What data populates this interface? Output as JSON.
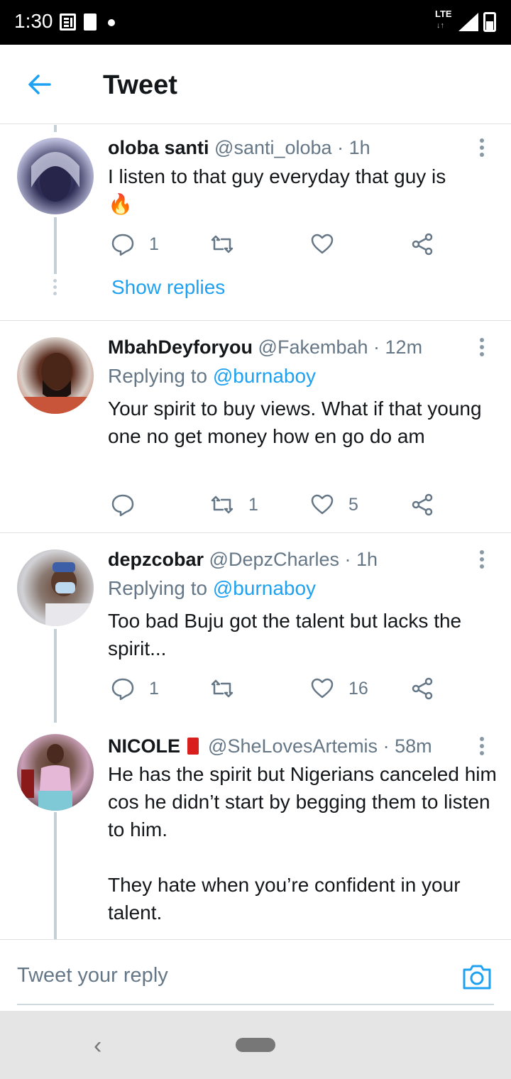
{
  "status": {
    "time": "1:30",
    "network": "LTE"
  },
  "header": {
    "title": "Tweet"
  },
  "tweets": [
    {
      "name": "oloba santi",
      "handle": "@santi_oloba",
      "time": "· 1h",
      "text": "I listen to that guy everyday that guy is",
      "emoji": "🔥",
      "reply_count": "1",
      "retweet_count": "",
      "like_count": "",
      "show_replies": "Show replies"
    },
    {
      "name": "MbahDeyforyou",
      "handle": "@Fakembah",
      "time": "· 12m",
      "replying_prefix": "Replying to",
      "replying_handle": "@burnaboy",
      "text": "Your spirit to buy views. What if that young one no get money how en go do am",
      "reply_count": "",
      "retweet_count": "1",
      "like_count": "5"
    },
    {
      "name": "depzcobar",
      "handle": "@DepzCharles",
      "time": "· 1h",
      "replying_prefix": "Replying to",
      "replying_handle": "@burnaboy",
      "text": "Too bad Buju got the talent but lacks the spirit...",
      "reply_count": "1",
      "retweet_count": "",
      "like_count": "16"
    },
    {
      "name": "NICOLE",
      "handle": "@SheLovesArtemis",
      "time": "· 58m",
      "text_p1": "He has the spirit but Nigerians canceled him cos he didn’t start by begging them to listen to him.",
      "text_p2": "They hate when you’re confident in your talent."
    }
  ],
  "reply_bar": {
    "placeholder": "Tweet your reply"
  },
  "colors": {
    "accent": "#1da1f2",
    "muted": "#657786",
    "thread": "#c4cfd6"
  }
}
